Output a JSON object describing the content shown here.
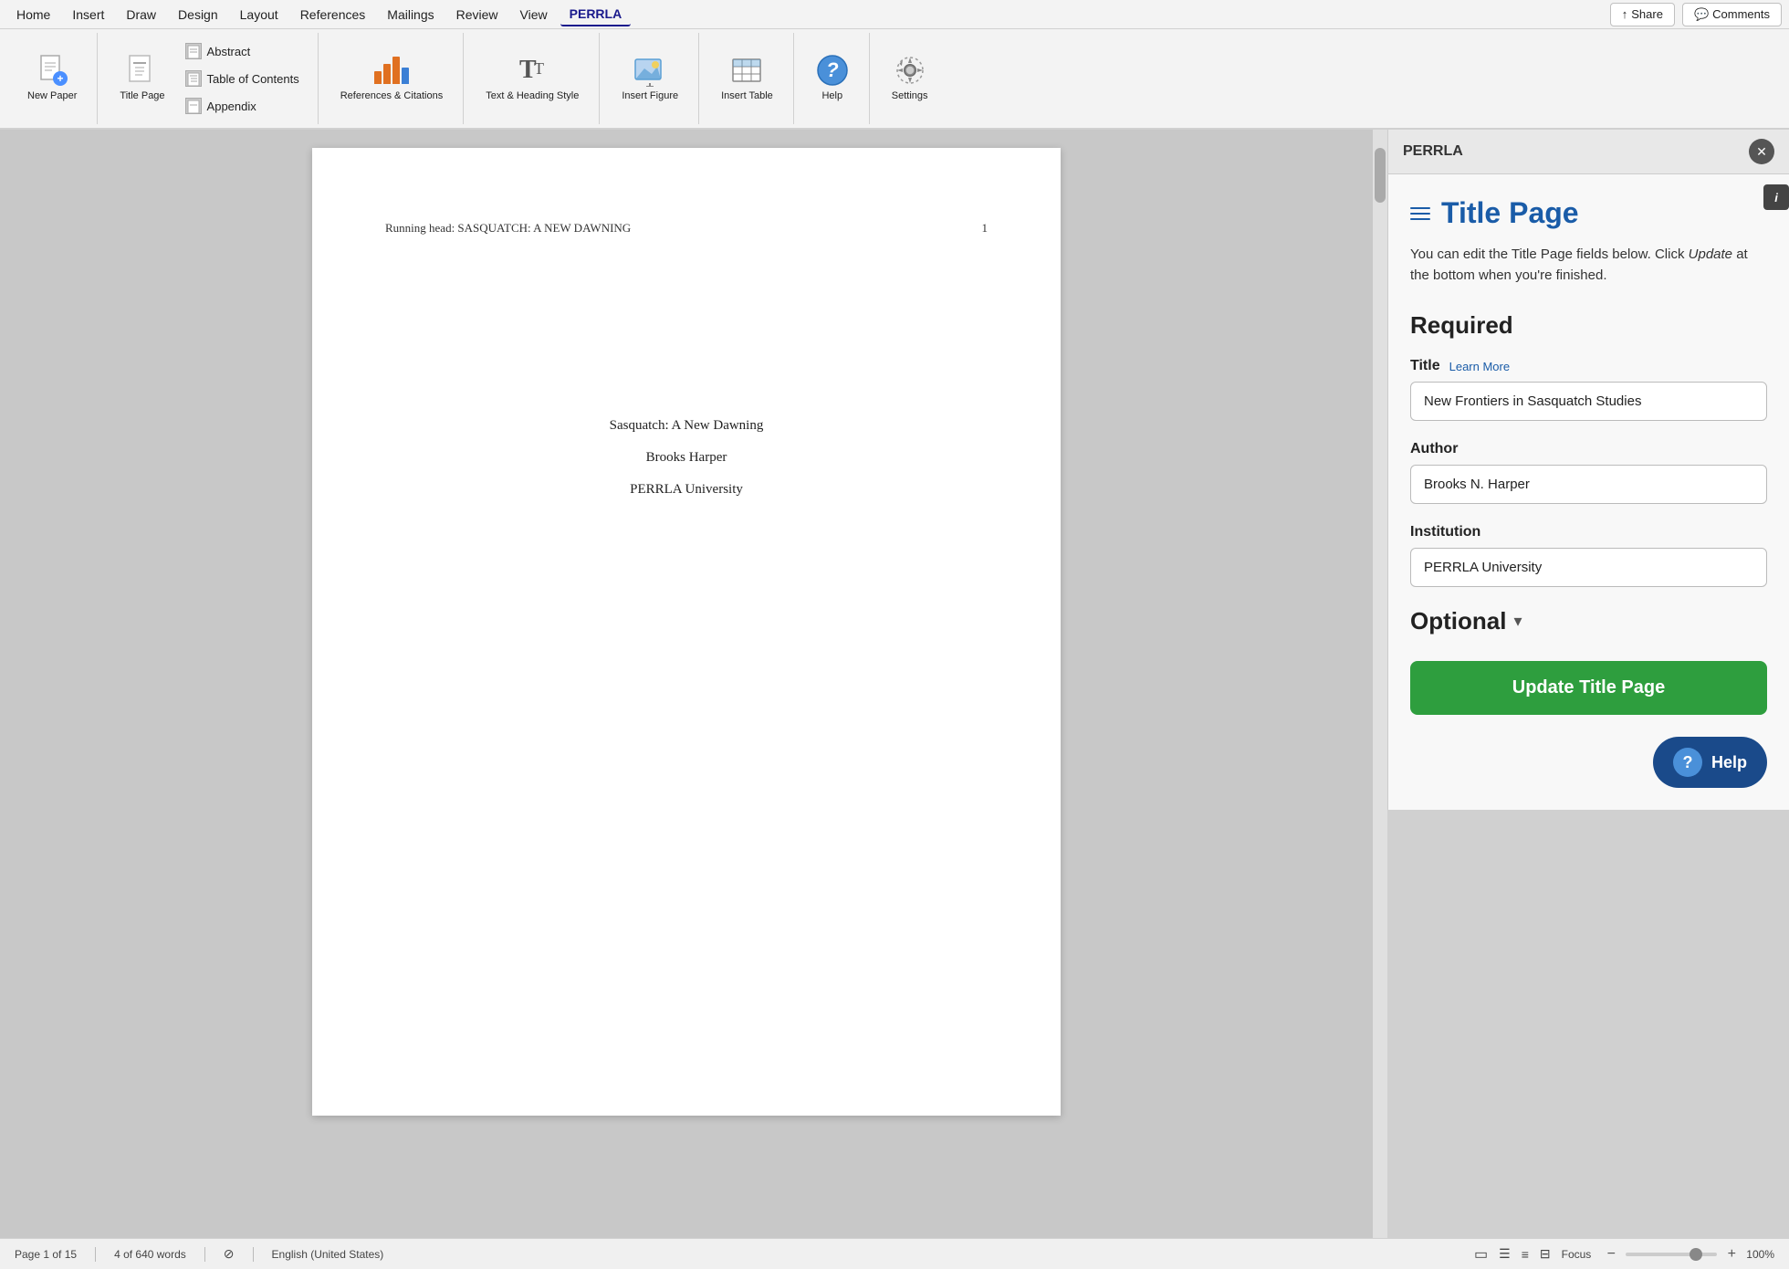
{
  "menubar": {
    "items": [
      {
        "label": "Home",
        "active": false
      },
      {
        "label": "Insert",
        "active": false
      },
      {
        "label": "Draw",
        "active": false
      },
      {
        "label": "Design",
        "active": false
      },
      {
        "label": "Layout",
        "active": false
      },
      {
        "label": "References",
        "active": false
      },
      {
        "label": "Mailings",
        "active": false
      },
      {
        "label": "Review",
        "active": false
      },
      {
        "label": "View",
        "active": false
      },
      {
        "label": "PERRLA",
        "active": true
      }
    ],
    "share_label": "Share",
    "comments_label": "Comments"
  },
  "ribbon": {
    "new_paper_label": "New\nPaper",
    "title_page_label": "Title\nPage",
    "abstract_label": "Abstract",
    "table_of_contents_label": "Table of Contents",
    "appendix_label": "Appendix",
    "references_citations_label": "References &\nCitations",
    "text_heading_style_label": "Text &\nHeading Style",
    "insert_figure_label": "Insert\nFigure",
    "insert_table_label": "Insert\nTable",
    "help_label": "Help",
    "settings_label": "Settings"
  },
  "document": {
    "running_head": "Running head: SASQUATCH: A NEW DAWNING",
    "page_number": "1",
    "paper_title": "Sasquatch: A New Dawning",
    "author": "Brooks Harper",
    "institution": "PERRLA University"
  },
  "panel": {
    "header_title": "PERRLA",
    "section_title": "Title Page",
    "description_part1": "You can edit the Title Page fields below. Click",
    "description_italic": "Update",
    "description_part2": "at the bottom when you're finished.",
    "required_heading": "Required",
    "title_label": "Title",
    "learn_more_label": "Learn More",
    "title_value": "New Frontiers in Sasquatch Studies",
    "author_label": "Author",
    "author_value": "Brooks N. Harper",
    "institution_label": "Institution",
    "institution_value": "PERRLA University",
    "optional_label": "Optional",
    "update_btn_label": "Update Title Page",
    "help_btn_label": "Help"
  },
  "statusbar": {
    "page_info": "Page 1 of 15",
    "word_count": "4 of 640 words",
    "language": "English (United States)",
    "focus_label": "Focus",
    "zoom_level": "100%"
  }
}
